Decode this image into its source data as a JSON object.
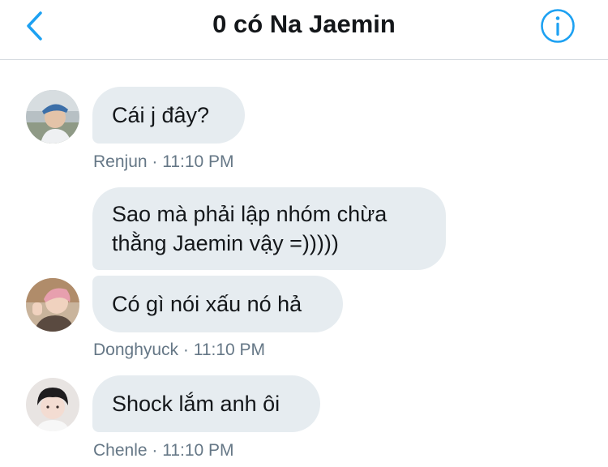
{
  "header": {
    "title": "0 có Na Jaemin",
    "back_icon": "chevron-left-icon",
    "info_icon": "info-icon",
    "accent_color": "#1da1f2"
  },
  "messages": [
    {
      "text": "Cái j đây?",
      "sender": "Renjun",
      "time": "11:10 PM",
      "meta": "Renjun · 11:10 PM"
    },
    {
      "text": "Sao mà phải lập nhóm chừa\nthằng Jaemin vậy =)))))",
      "sender": "Donghyuck",
      "time": "11:10 PM"
    },
    {
      "text": "Có gì nói xấu nó hả",
      "sender": "Donghyuck",
      "time": "11:10 PM",
      "meta": "Donghyuck · 11:10 PM"
    },
    {
      "text": "Shock lắm anh ôi",
      "sender": "Chenle",
      "time": "11:10 PM",
      "meta": "Chenle · 11:10 PM"
    }
  ],
  "colors": {
    "bubble": "#e6ecf0",
    "meta_text": "#657786",
    "title_text": "#14171a"
  }
}
